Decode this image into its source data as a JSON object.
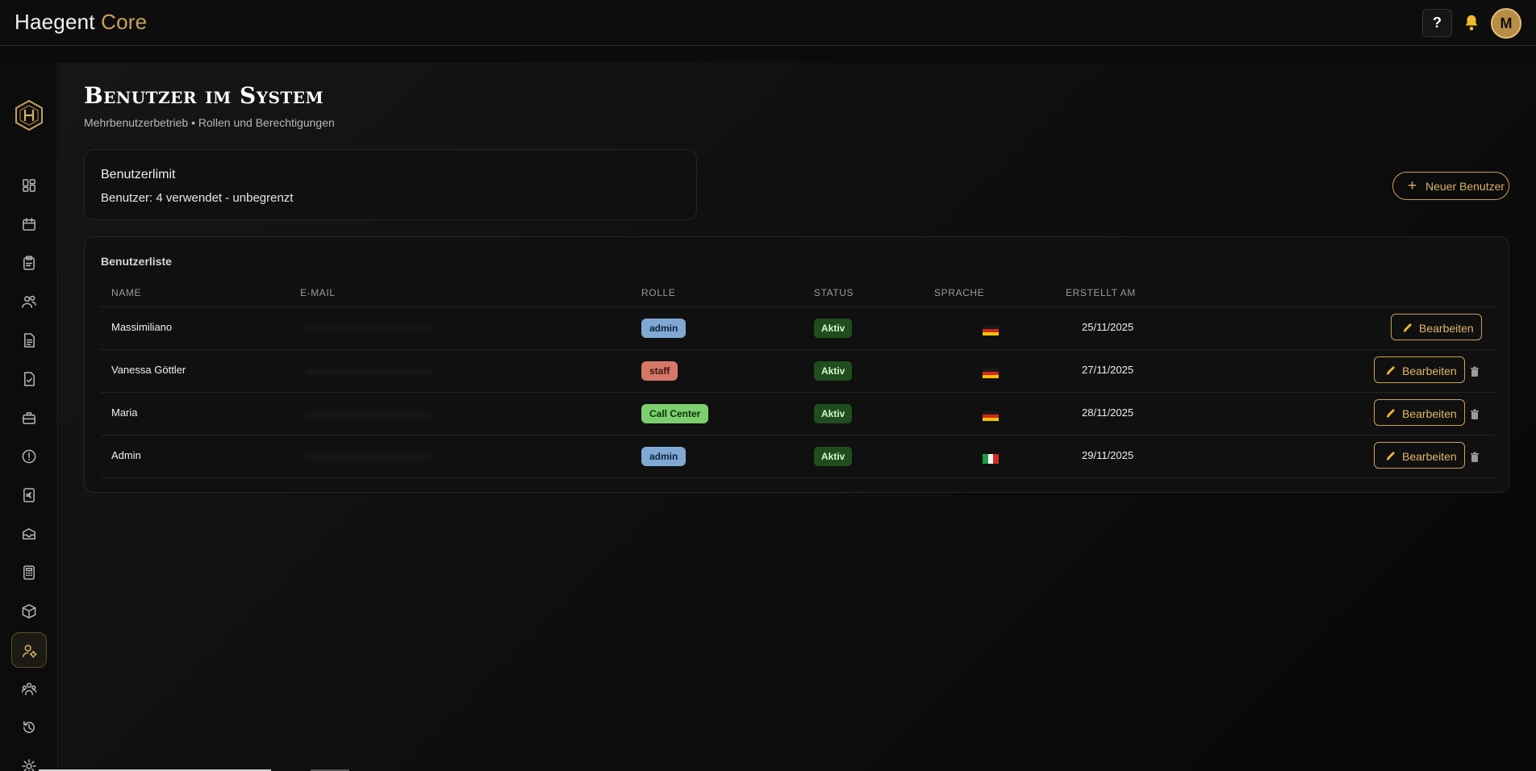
{
  "app": {
    "name": "Haegent",
    "name_accent": "Core"
  },
  "header": {
    "help_label": "?",
    "avatar_initial": "M"
  },
  "sidebar": {
    "items": [
      {
        "icon": "dashboard-icon"
      },
      {
        "icon": "calendar-icon"
      },
      {
        "icon": "clipboard-icon"
      },
      {
        "icon": "users-icon"
      },
      {
        "icon": "document-icon"
      },
      {
        "icon": "document-check-icon"
      },
      {
        "icon": "briefcase-icon"
      },
      {
        "icon": "alert-icon"
      },
      {
        "icon": "euro-icon"
      },
      {
        "icon": "inbox-icon"
      },
      {
        "icon": "calculator-icon"
      },
      {
        "icon": "package-icon"
      },
      {
        "icon": "user-settings-icon",
        "active": true
      },
      {
        "icon": "team-icon"
      },
      {
        "icon": "history-icon"
      },
      {
        "icon": "gear-icon"
      }
    ]
  },
  "page": {
    "title": "Benutzer im System",
    "subtitle": "Mehrbenutzerbetrieb • Rollen und Berechtigungen"
  },
  "limit": {
    "title": "Benutzerlimit",
    "value": "Benutzer: 4 verwendet - unbegrenzt"
  },
  "new_user_button": {
    "plus": "+",
    "label": "Neuer Benutzer"
  },
  "table": {
    "title": "Benutzerliste",
    "columns": [
      "Name",
      "E-Mail",
      "Rolle",
      "Status",
      "Sprache",
      "Erstellt am"
    ],
    "edit_label": "Bearbeiten",
    "rows": [
      {
        "name": "Massimiliano",
        "role": "admin",
        "status": "Aktiv",
        "language": "de",
        "created": "25/11/2025"
      },
      {
        "name": "Vanessa Göttler",
        "role": "staff",
        "status": "Aktiv",
        "language": "de",
        "created": "27/11/2025"
      },
      {
        "name": "Maria",
        "role": "Call Center",
        "status": "Aktiv",
        "language": "de",
        "created": "28/11/2025"
      },
      {
        "name": "Admin",
        "role": "admin",
        "status": "Aktiv",
        "language": "it",
        "created": "29/11/2025"
      }
    ]
  },
  "colors": {
    "accent": "#c9a15a",
    "admin_badge": "#7fa9d4",
    "staff_badge": "#d57868",
    "callcenter_badge": "#7dcf6e",
    "status_active": "#1f4d1d"
  }
}
